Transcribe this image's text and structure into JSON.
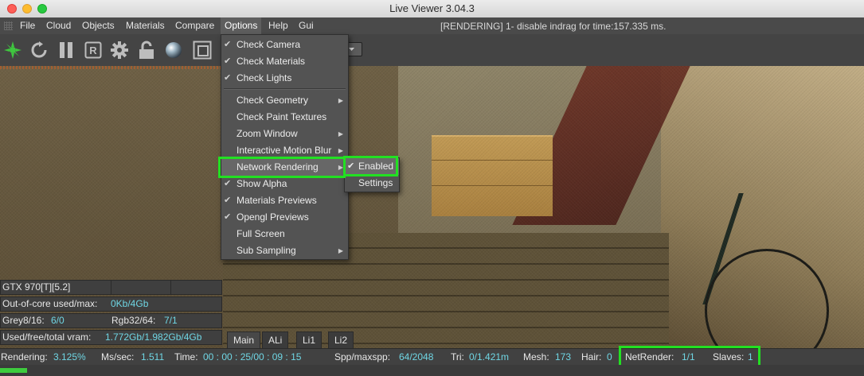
{
  "window": {
    "title": "Live Viewer 3.04.3"
  },
  "menubar": {
    "items": [
      "File",
      "Cloud",
      "Objects",
      "Materials",
      "Compare",
      "Options",
      "Help",
      "Gui"
    ],
    "status": "[RENDERING] 1- disable indrag for time:157.335 ms."
  },
  "toolbar": {
    "icons": [
      "octane-logo-icon",
      "refresh-icon",
      "pause-icon",
      "r-icon",
      "gear-icon",
      "lock-icon",
      "material-ball-icon",
      "region-icon"
    ]
  },
  "options_menu": {
    "items": [
      {
        "label": "Check Camera",
        "checked": true,
        "submenu": false
      },
      {
        "label": "Check Materials",
        "checked": true,
        "submenu": false
      },
      {
        "label": "Check Lights",
        "checked": true,
        "submenu": false
      },
      {
        "label": "Check Geometry",
        "checked": false,
        "submenu": true
      },
      {
        "label": "Check Paint Textures",
        "checked": false,
        "submenu": false
      },
      {
        "label": "Zoom Window",
        "checked": false,
        "submenu": true
      },
      {
        "label": "Interactive Motion Blur",
        "checked": false,
        "submenu": true
      },
      {
        "label": "Network Rendering",
        "checked": false,
        "submenu": true
      },
      {
        "label": "Show Alpha",
        "checked": true,
        "submenu": false
      },
      {
        "label": "Materials Previews",
        "checked": true,
        "submenu": false
      },
      {
        "label": "Opengl Previews",
        "checked": true,
        "submenu": false
      },
      {
        "label": "Full Screen",
        "checked": false,
        "submenu": false
      },
      {
        "label": "Sub Sampling",
        "checked": false,
        "submenu": true
      }
    ],
    "network_submenu": [
      {
        "label": "Enabled",
        "checked": true
      },
      {
        "label": "Settings",
        "checked": false
      }
    ]
  },
  "info_panel": {
    "gpu": "GTX 970[T][5.2]",
    "ooc_label": "Out-of-core used/max:",
    "ooc_value": "0Kb/4Gb",
    "grey_label": "Grey8/16:",
    "grey_value": "6/0",
    "rgb_label": "Rgb32/64:",
    "rgb_value": "7/1",
    "vram_label": "Used/free/total vram:",
    "vram_value": "1.772Gb/1.982Gb/4Gb"
  },
  "tabs": [
    "Main",
    "ALi",
    "Li1",
    "Li2"
  ],
  "statusbar": {
    "rendering_label": "Rendering:",
    "rendering_value": "3.125%",
    "ms_label": "Ms/sec:",
    "ms_value": "1.511",
    "time_label": "Time:",
    "time_value": "00 : 00 : 25/00 : 09 : 15",
    "spp_label": "Spp/maxspp:",
    "spp_value": "64/2048",
    "tri_label": "Tri:",
    "tri_value": "0/1.421m",
    "mesh_label": "Mesh:",
    "mesh_value": "173",
    "hair_label": "Hair:",
    "hair_value": "0",
    "netrender_label": "NetRender:",
    "netrender_value": "1/1",
    "slaves_label": "Slaves:",
    "slaves_value": "1"
  },
  "progress": {
    "fraction": 0.03125
  },
  "colors": {
    "highlight": "#22e022",
    "value": "#6fd6e4",
    "progress": "#3ecc3e"
  }
}
